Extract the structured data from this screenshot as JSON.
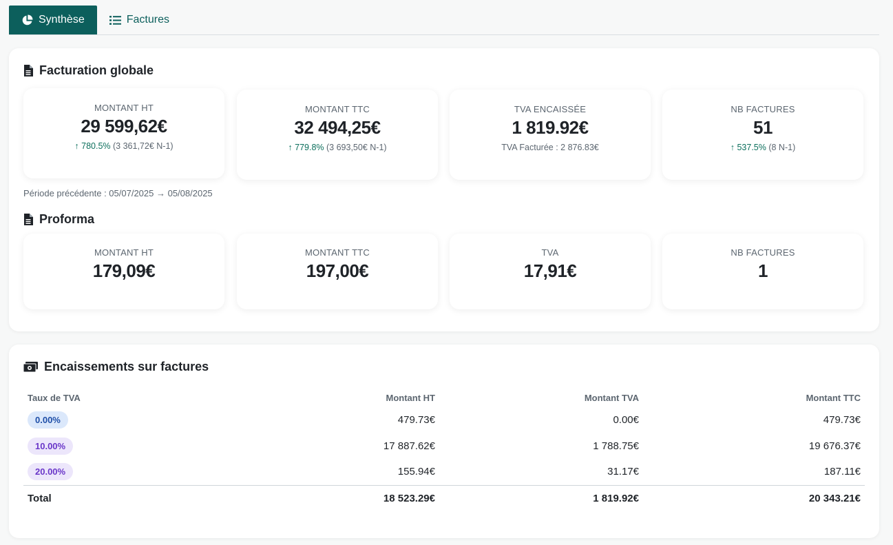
{
  "tabs": [
    {
      "label": "Synthèse",
      "active": true,
      "icon": "pie-chart-icon"
    },
    {
      "label": "Factures",
      "active": false,
      "icon": "list-icon"
    }
  ],
  "colors": {
    "accent": "#0c5f5c",
    "positive": "#0c6f5c"
  },
  "facturation": {
    "title": "Facturation globale",
    "icon": "document-icon",
    "cards": [
      {
        "label": "MONTANT HT",
        "value": "29 599,62€",
        "change": "↑ 780.5%",
        "ref": "(3 361,72€ N-1)"
      },
      {
        "label": "MONTANT TTC",
        "value": "32 494,25€",
        "change": "↑ 779.8%",
        "ref": "(3 693,50€ N-1)"
      },
      {
        "label": "TVA ENCAISSÉE",
        "value": "1 819.92€",
        "note": "TVA Facturée : 2 876.83€"
      },
      {
        "label": "NB FACTURES",
        "value": "51",
        "change": "↑ 537.5%",
        "ref": "(8 N-1)"
      }
    ],
    "period_note": "Période précédente : 05/07/2025 → 05/08/2025"
  },
  "proforma": {
    "title": "Proforma",
    "icon": "document-icon",
    "cards": [
      {
        "label": "MONTANT HT",
        "value": "179,09€"
      },
      {
        "label": "MONTANT TTC",
        "value": "197,00€"
      },
      {
        "label": "TVA",
        "value": "17,91€"
      },
      {
        "label": "NB FACTURES",
        "value": "1"
      }
    ]
  },
  "encaissements": {
    "title": "Encaissements sur factures",
    "icon": "money-icon",
    "headers": [
      "Taux de TVA",
      "Montant HT",
      "Montant TVA",
      "Montant TTC"
    ],
    "rows": [
      {
        "rate": "0.00%",
        "ht": "479.73€",
        "tva": "0.00€",
        "ttc": "479.73€",
        "badge_bg": "#dbe8fb",
        "badge_fg": "#1f4fa8"
      },
      {
        "rate": "10.00%",
        "ht": "17 887.62€",
        "tva": "1 788.75€",
        "ttc": "19 676.37€",
        "badge_bg": "#ece6fb",
        "badge_fg": "#6a37c9"
      },
      {
        "rate": "20.00%",
        "ht": "155.94€",
        "tva": "31.17€",
        "ttc": "187.11€",
        "badge_bg": "#ece6fb",
        "badge_fg": "#6a37c9"
      }
    ],
    "total": {
      "label": "Total",
      "ht": "18 523.29€",
      "tva": "1 819.92€",
      "ttc": "20 343.21€"
    }
  }
}
